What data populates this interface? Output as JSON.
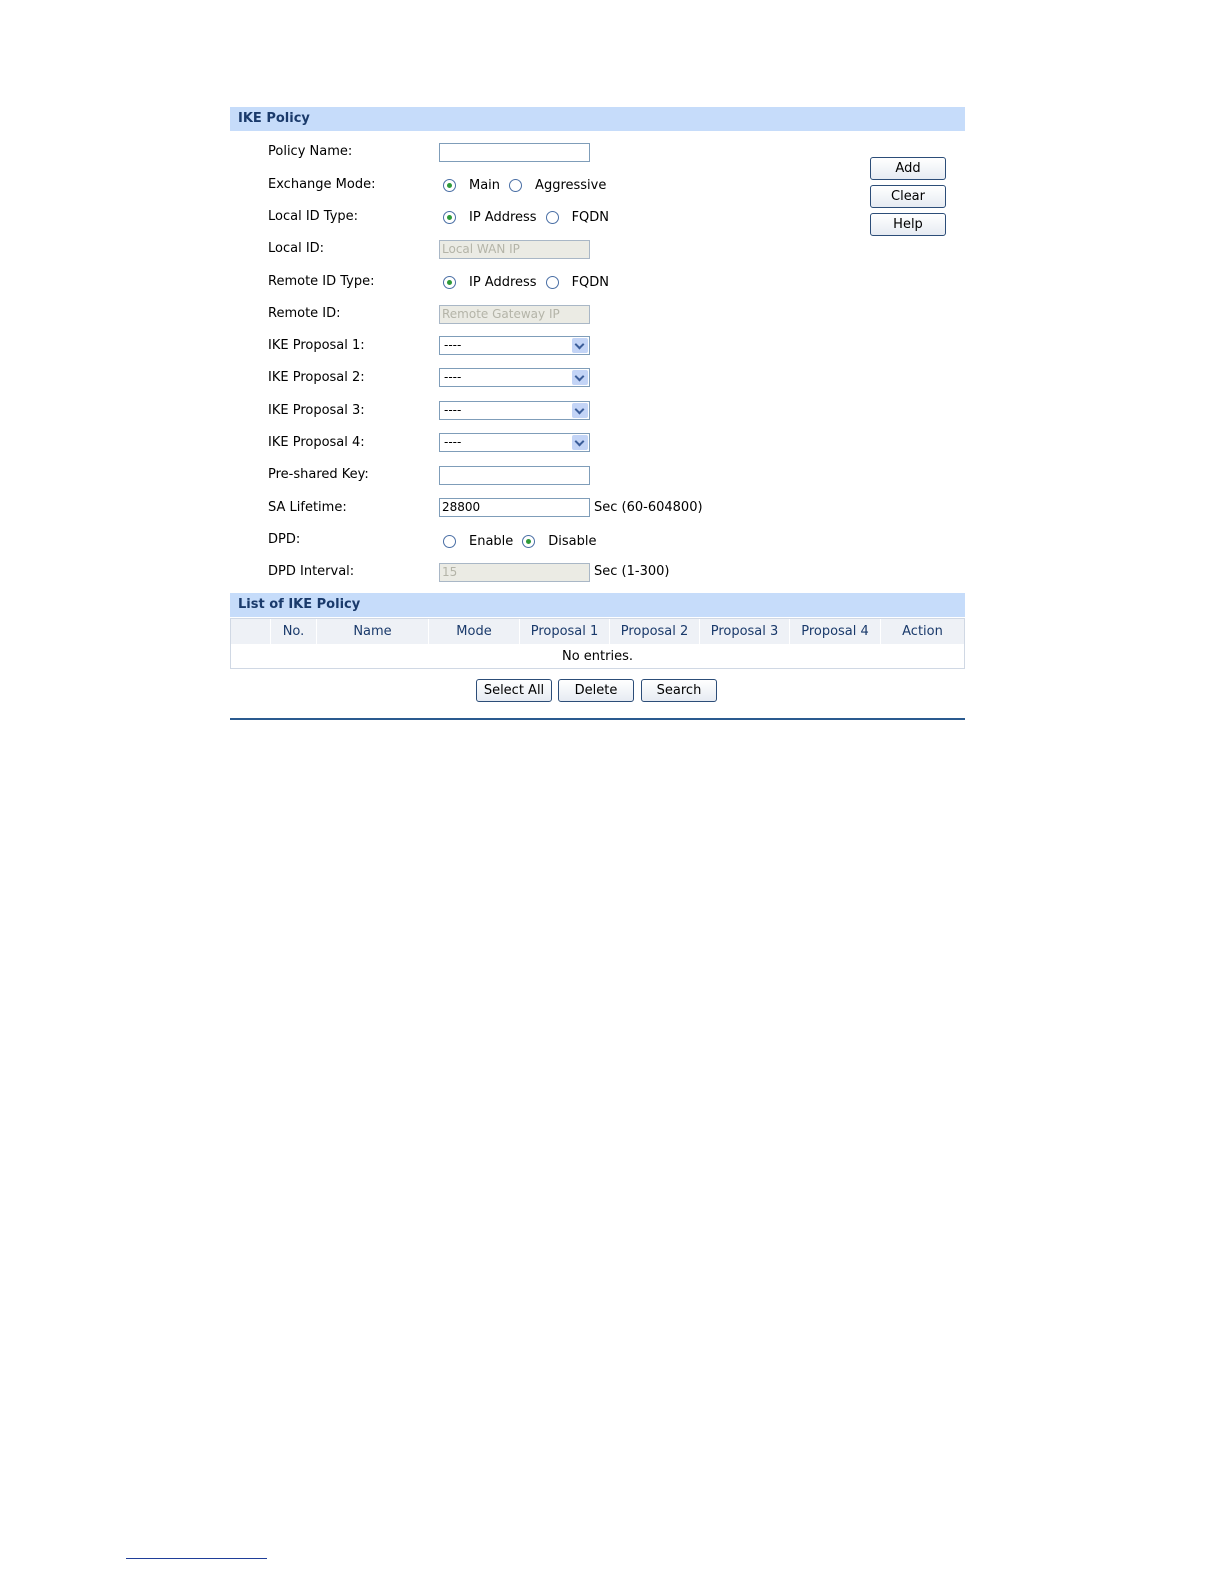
{
  "ike_policy": {
    "header": "IKE Policy",
    "fields": {
      "policy_name": {
        "label": "Policy Name:",
        "value": ""
      },
      "exchange_mode": {
        "label": "Exchange Mode:",
        "options": [
          "Main",
          "Aggressive"
        ],
        "selected": "Main"
      },
      "local_id_type": {
        "label": "Local ID Type:",
        "options": [
          "IP Address",
          "FQDN"
        ],
        "selected": "IP Address"
      },
      "local_id": {
        "label": "Local ID:",
        "value": "Local WAN IP"
      },
      "remote_id_type": {
        "label": "Remote ID Type:",
        "options": [
          "IP Address",
          "FQDN"
        ],
        "selected": "IP Address"
      },
      "remote_id": {
        "label": "Remote ID:",
        "value": "Remote Gateway IP"
      },
      "proposal1": {
        "label": "IKE Proposal 1:",
        "value": "----"
      },
      "proposal2": {
        "label": "IKE Proposal 2:",
        "value": "----"
      },
      "proposal3": {
        "label": "IKE Proposal 3:",
        "value": "----"
      },
      "proposal4": {
        "label": "IKE Proposal 4:",
        "value": "----"
      },
      "psk": {
        "label": "Pre-shared Key:",
        "value": ""
      },
      "sa_lifetime": {
        "label": "SA Lifetime:",
        "value": "28800",
        "unit": "Sec (60-604800)"
      },
      "dpd": {
        "label": "DPD:",
        "options": [
          "Enable",
          "Disable"
        ],
        "selected": "Disable"
      },
      "dpd_interval": {
        "label": "DPD Interval:",
        "value": "15",
        "unit": "Sec (1-300)"
      }
    },
    "buttons": {
      "add": "Add",
      "clear": "Clear",
      "help": "Help"
    }
  },
  "list": {
    "header": "List of IKE Policy",
    "columns": [
      "",
      "No.",
      "Name",
      "Mode",
      "Proposal 1",
      "Proposal 2",
      "Proposal 3",
      "Proposal 4",
      "Action"
    ],
    "empty": "No entries.",
    "buttons": {
      "select_all": "Select All",
      "delete": "Delete",
      "search": "Search"
    }
  },
  "colors": {
    "header_bg": "#c6dcfa",
    "header_text": "#1a3a6b",
    "radio_dot": "#2e9a3a"
  }
}
